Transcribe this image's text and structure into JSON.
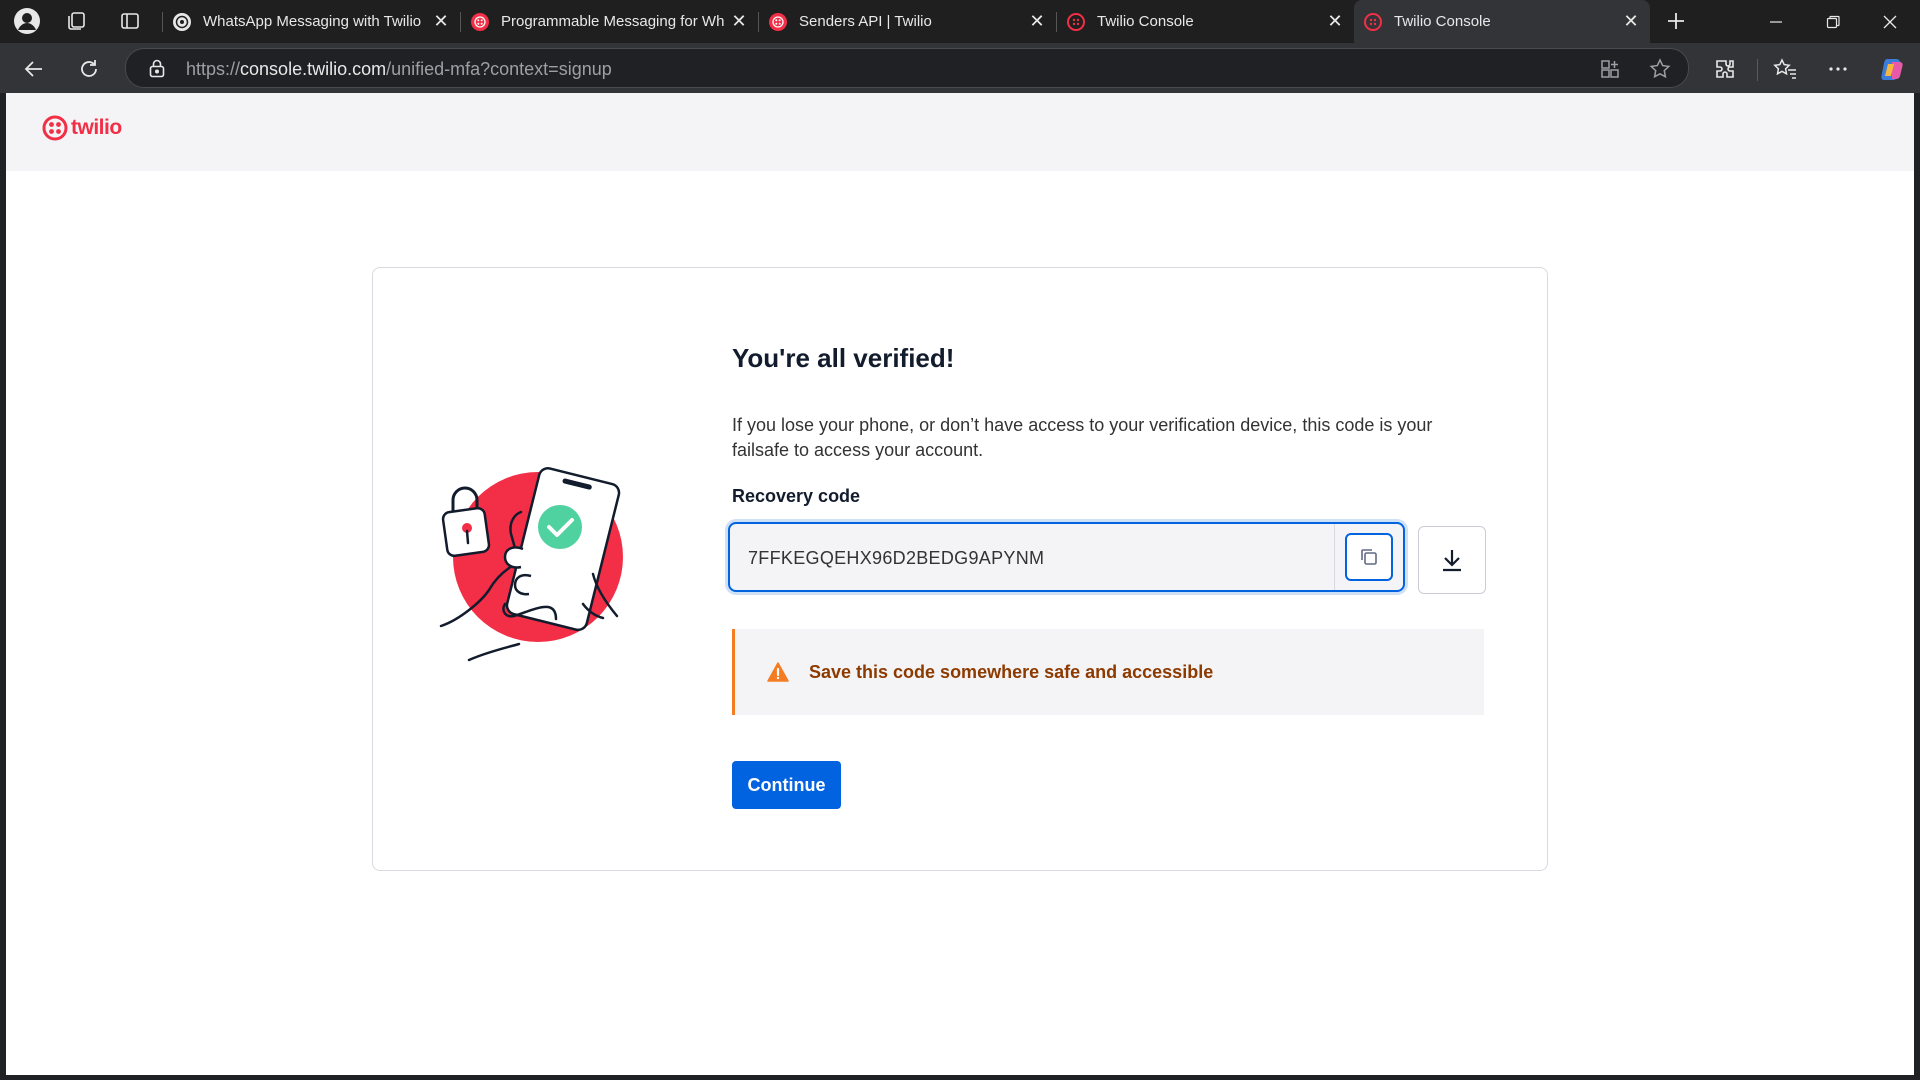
{
  "browser": {
    "tabs": [
      {
        "label": "WhatsApp Messaging with Twilio",
        "favicon": "whatsapp-icon",
        "active": false
      },
      {
        "label": "Programmable Messaging for Wh",
        "favicon": "twilio-icon",
        "active": false
      },
      {
        "label": "Senders API | Twilio",
        "favicon": "twilio-icon",
        "active": false
      },
      {
        "label": "Twilio Console",
        "favicon": "twilio-icon",
        "active": false
      },
      {
        "label": "Twilio Console",
        "favicon": "twilio-icon",
        "active": true
      }
    ],
    "url_prefix": "https://",
    "url_host": "console.twilio.com",
    "url_path": "/unified-mfa?context=signup"
  },
  "page": {
    "logo_text": "twilio",
    "heading": "You're all verified!",
    "description": "If you lose your phone, or don’t have access to your verification device, this code is your failsafe to access your account.",
    "recovery_label": "Recovery code",
    "recovery_code": "7FFKEGQEHX96D2BEDG9APYNM",
    "alert_text": "Save this code somewhere safe and accessible",
    "continue_label": "Continue"
  },
  "colors": {
    "brand": "#f22f46",
    "primary": "#0263e0",
    "warning": "#f47c22",
    "warning_text": "#8d3a00",
    "success": "#4fd1a0"
  }
}
